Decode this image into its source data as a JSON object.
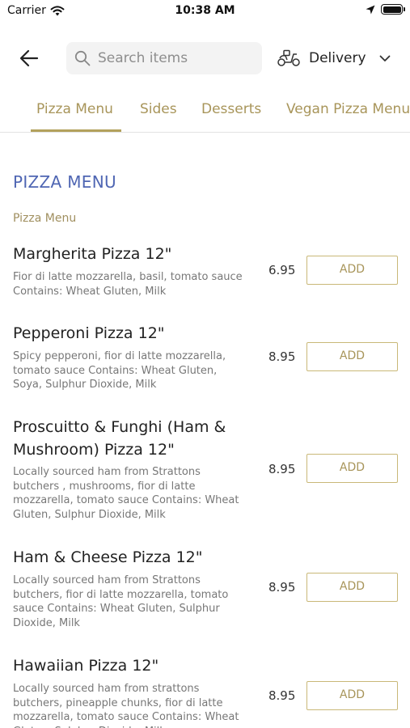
{
  "status_bar": {
    "carrier": "Carrier",
    "time": "10:38 AM"
  },
  "header": {
    "search_placeholder": "Search items",
    "delivery_label": "Delivery"
  },
  "tabs": [
    {
      "label": "Pizza Menu",
      "active": true
    },
    {
      "label": "Sides"
    },
    {
      "label": "Desserts"
    },
    {
      "label": "Vegan Pizza Menu"
    }
  ],
  "section_title": "PIZZA MENU",
  "category_label": "Pizza Menu",
  "items": [
    {
      "name": "Margherita Pizza 12\"",
      "description": "Fior di latte mozzarella, basil, tomato sauce   Contains: Wheat Gluten, Milk",
      "price": "6.95",
      "add_label": "ADD"
    },
    {
      "name": "Pepperoni Pizza 12\"",
      "description": "Spicy pepperoni, fior di latte mozzarella, tomato sauce   Contains: Wheat Gluten, Soya, Sulphur Dioxide, Milk",
      "price": "8.95",
      "add_label": "ADD"
    },
    {
      "name": "Proscuitto & Funghi (Ham & Mushroom) Pizza 12\"",
      "description": "Locally sourced ham from Strattons butchers , mushrooms, fior di latte mozzarella, tomato sauce   Contains: Wheat Gluten, Sulphur Dioxide, Milk",
      "price": "8.95",
      "add_label": "ADD"
    },
    {
      "name": "Ham & Cheese Pizza 12\"",
      "description": "Locally sourced ham from Strattons butchers, fior di latte mozzarella, tomato sauce   Contains: Wheat Gluten, Sulphur Dioxide, Milk",
      "price": "8.95",
      "add_label": "ADD"
    },
    {
      "name": "Hawaiian Pizza 12\"",
      "description": "Locally sourced ham from strattons butchers, pineapple chunks, fior di latte mozzarella, tomato sauce   Contains: Wheat Gluten, Sulphur Dioxide, Milk",
      "price": "8.95",
      "add_label": "ADD"
    }
  ],
  "colors": {
    "accent_gold": "#a8955a",
    "section_blue": "#4f66b3"
  },
  "icons": {
    "back": "arrow-left-icon",
    "search": "search-icon",
    "delivery": "scooter-icon",
    "dropdown": "chevron-down-icon"
  }
}
